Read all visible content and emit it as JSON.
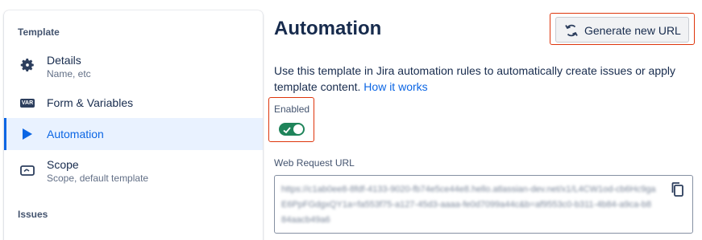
{
  "sidebar": {
    "template_heading": "Template",
    "issues_heading": "Issues",
    "items": [
      {
        "title": "Details",
        "subtitle": "Name, etc",
        "icon": "gear-icon"
      },
      {
        "title": "Form & Variables",
        "subtitle": "",
        "icon": "var-icon",
        "icon_text": "VAR"
      },
      {
        "title": "Automation",
        "subtitle": "",
        "icon": "play-icon",
        "selected": true
      },
      {
        "title": "Scope",
        "subtitle": "Scope, default template",
        "icon": "scope-icon"
      }
    ]
  },
  "main": {
    "title": "Automation",
    "generate_button_label": "Generate new URL",
    "description": "Use this template in Jira automation rules to automatically create issues or apply template content.",
    "how_it_works_link": "How it works",
    "enabled_label": "Enabled",
    "enabled": true,
    "web_request_label": "Web Request URL",
    "web_request_url": "https://c1ab0ee8-8fdf-4133-9020-fb74e5ce44e8.hello.atlassian-dev.net/x1/L4CW1od-cb6Hc9gaE6PpFGdgxQY1a=fa553f75-a127-45d3-aaaa-fe0d7099a44c&b=af9553c0-b311-4b84-a9ca-b884aacb49a6"
  },
  "colors": {
    "accent": "#0c66e4",
    "toggle_on": "#1f845a",
    "highlight": "#de350b"
  }
}
